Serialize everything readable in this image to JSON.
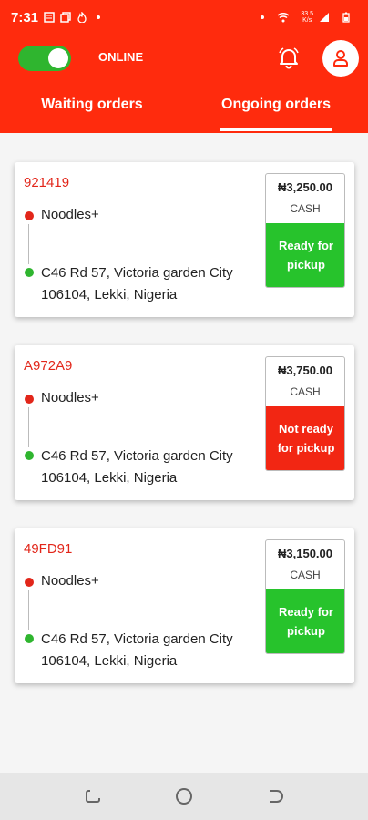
{
  "status_bar": {
    "time": "7:31",
    "speed_top": "33.5",
    "speed_bottom": "K/s"
  },
  "header": {
    "online_label": "ONLINE"
  },
  "tabs": [
    {
      "label": "Waiting orders",
      "active": false
    },
    {
      "label": "Ongoing orders",
      "active": true
    }
  ],
  "orders": [
    {
      "code": "921419",
      "item": "Noodles+",
      "address": "C46 Rd 57, Victoria garden City 106104, Lekki, Nigeria",
      "price": "₦3,250.00",
      "method": "CASH",
      "status": "Ready for pickup",
      "status_type": "ready"
    },
    {
      "code": "A972A9",
      "item": "Noodles+",
      "address": "C46 Rd 57, Victoria garden City 106104, Lekki, Nigeria",
      "price": "₦3,750.00",
      "method": "CASH",
      "status": "Not ready for pickup",
      "status_type": "notready"
    },
    {
      "code": "49FD91",
      "item": "Noodles+",
      "address": "C46 Rd 57, Victoria garden City 106104, Lekki, Nigeria",
      "price": "₦3,150.00",
      "method": "CASH",
      "status": "Ready for pickup",
      "status_type": "ready"
    }
  ],
  "icons": {
    "bell": "bell-icon",
    "profile": "user-icon",
    "nav_recent": "recent-apps-icon",
    "nav_home": "home-icon",
    "nav_back": "back-icon"
  },
  "colors": {
    "brand": "#ff2b0d",
    "ready": "#27c32c",
    "not_ready": "#f22613",
    "code": "#e2261a",
    "online": "#2fb52f"
  }
}
